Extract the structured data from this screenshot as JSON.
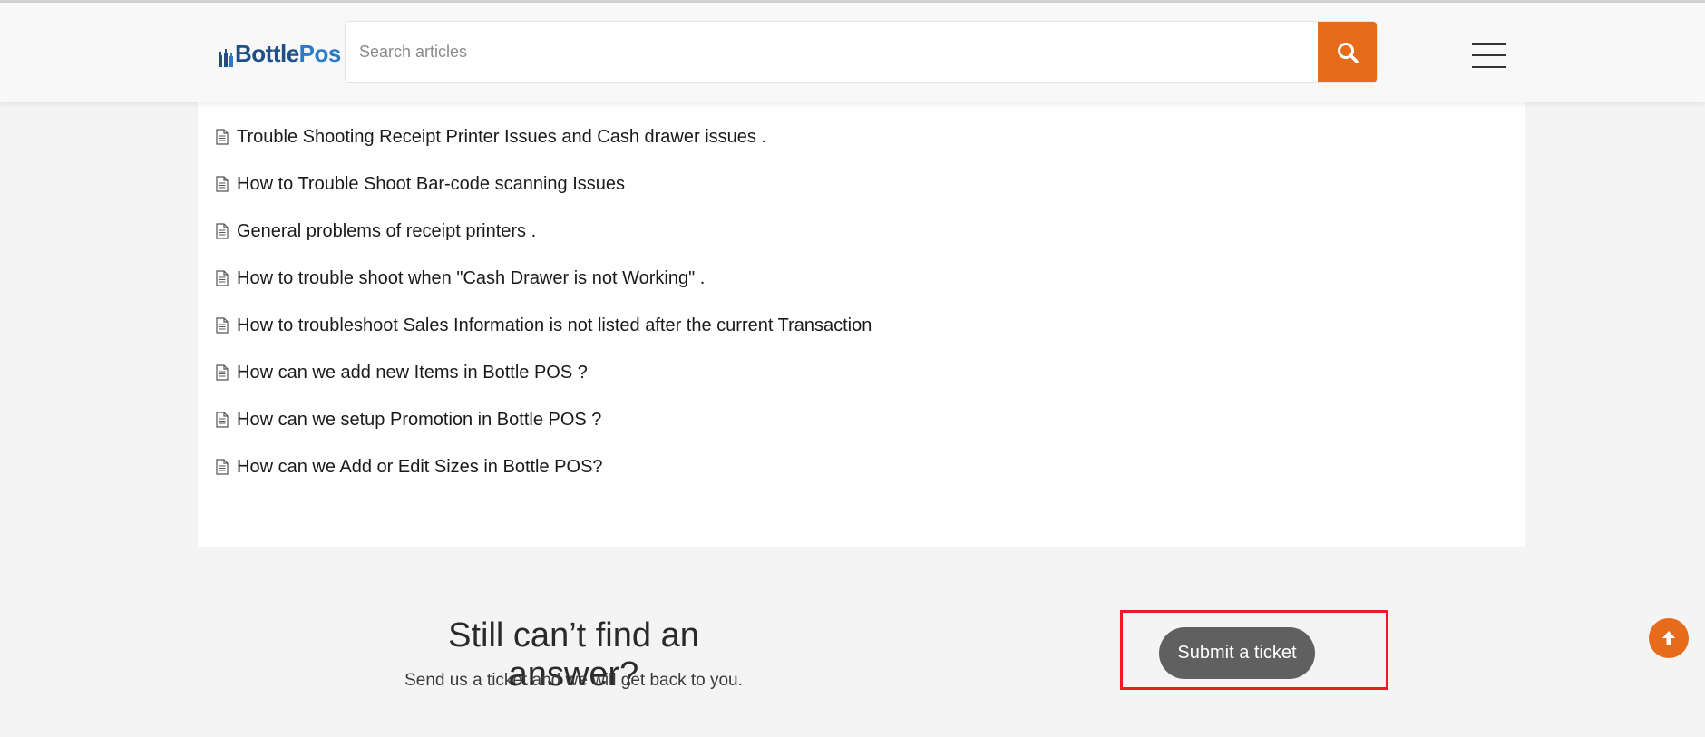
{
  "header": {
    "logo": {
      "part1": "Bottle",
      "part2": "Pos"
    },
    "search": {
      "placeholder": "Search articles",
      "value": ""
    },
    "search_button_icon": "search-icon",
    "menu_icon": "hamburger-menu-icon"
  },
  "articles": [
    {
      "title": "Trouble Shooting Receipt Printer Issues and Cash drawer issues ."
    },
    {
      "title": "How to Trouble Shoot Bar-code scanning Issues"
    },
    {
      "title": "General problems of receipt printers ."
    },
    {
      "title": "How to trouble shoot when \"Cash Drawer is not Working\" ."
    },
    {
      "title": "How to troubleshoot Sales Information is not listed after the current Transaction"
    },
    {
      "title": "How can we add new Items in Bottle POS ?"
    },
    {
      "title": "How can we setup Promotion in Bottle POS ?"
    },
    {
      "title": "How can we Add or Edit Sizes in Bottle POS?"
    }
  ],
  "cta": {
    "title": "Still can’t find an answer?",
    "subtitle": "Send us a ticket and we will get back to you.",
    "button_label": "Submit a ticket"
  },
  "scroll_top_icon": "arrow-up-icon",
  "colors": {
    "accent": "#e86b1c",
    "button_gray": "#606060",
    "highlight_red": "#ee1b24",
    "logo_dark": "#1f4f86",
    "logo_light": "#2b7bc6"
  }
}
